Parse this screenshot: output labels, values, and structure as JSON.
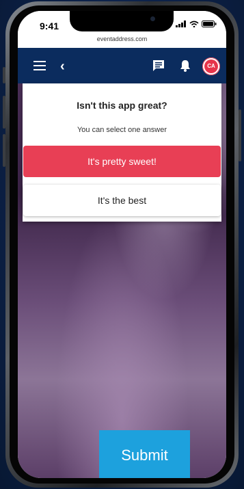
{
  "status_bar": {
    "time": "9:41"
  },
  "browser": {
    "url": "eventaddress.com"
  },
  "appbar": {
    "avatar_initials": "CA"
  },
  "poll": {
    "question": "Isn't this app great?",
    "instructions": "You can select one answer",
    "options": [
      {
        "label": "It's pretty sweet!",
        "selected": true
      },
      {
        "label": "It's the best",
        "selected": false
      }
    ]
  },
  "actions": {
    "submit_label": "Submit"
  },
  "colors": {
    "appbar": "#0b2c5e",
    "selected_option": "#e83f55",
    "submit_button": "#1da1dd",
    "avatar": "#e6344b"
  },
  "icons": [
    "menu-icon",
    "back-icon",
    "chat-icon",
    "bell-icon",
    "signal-icon",
    "wifi-icon",
    "battery-icon"
  ]
}
